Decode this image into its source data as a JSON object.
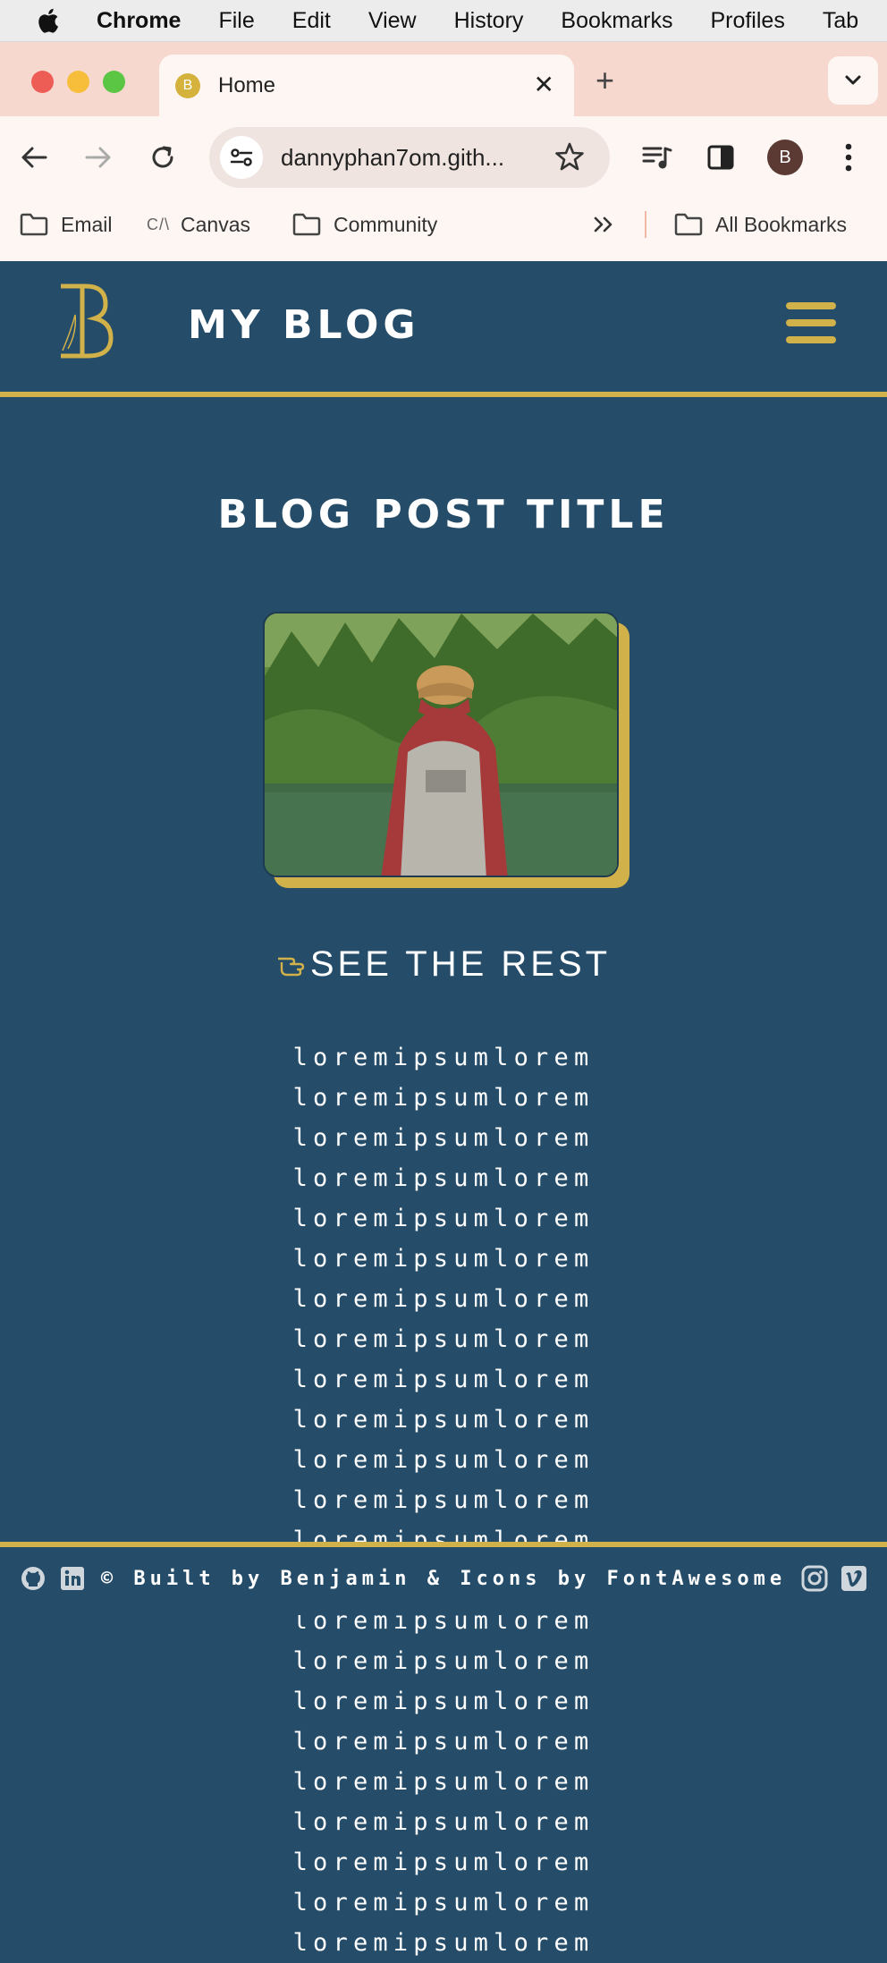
{
  "menubar": {
    "app": "Chrome",
    "items": [
      "File",
      "Edit",
      "View",
      "History",
      "Bookmarks",
      "Profiles",
      "Tab"
    ]
  },
  "browser": {
    "tab_title": "Home",
    "tab_favicon": "B",
    "url": "dannyphan7om.gith...",
    "profile_initial": "B"
  },
  "bookmarks": {
    "email": "Email",
    "canvas_glyph": "C/\\",
    "canvas": "Canvas",
    "community": "Community",
    "all": "All Bookmarks"
  },
  "site": {
    "title": "MY BLOG",
    "accent": "#d1b14a",
    "background": "#254c68"
  },
  "post": {
    "title": "BLOG POST TITLE",
    "see_rest": "SEE THE REST",
    "body": "loremipsumlorem loremipsumlorem loremipsumlorem loremipsumlorem loremipsumlorem loremipsumlorem loremipsumlorem loremipsumlorem loremipsumlorem loremipsumlorem loremipsumlorem loremipsumlorem loremipsumlorem loremipsumlorem loremipsumlorem loremipsumlorem loremipsumlorem loremipsumlorem loremipsumlorem loremipsumlorem loremipsumlorem loremipsumlorem loremipsumlorem"
  },
  "footer": {
    "credit": "© Built by Benjamin & Icons by FontAwesome",
    "icons": [
      "github-icon",
      "linkedin-icon",
      "instagram-icon",
      "vimeo-icon"
    ]
  }
}
